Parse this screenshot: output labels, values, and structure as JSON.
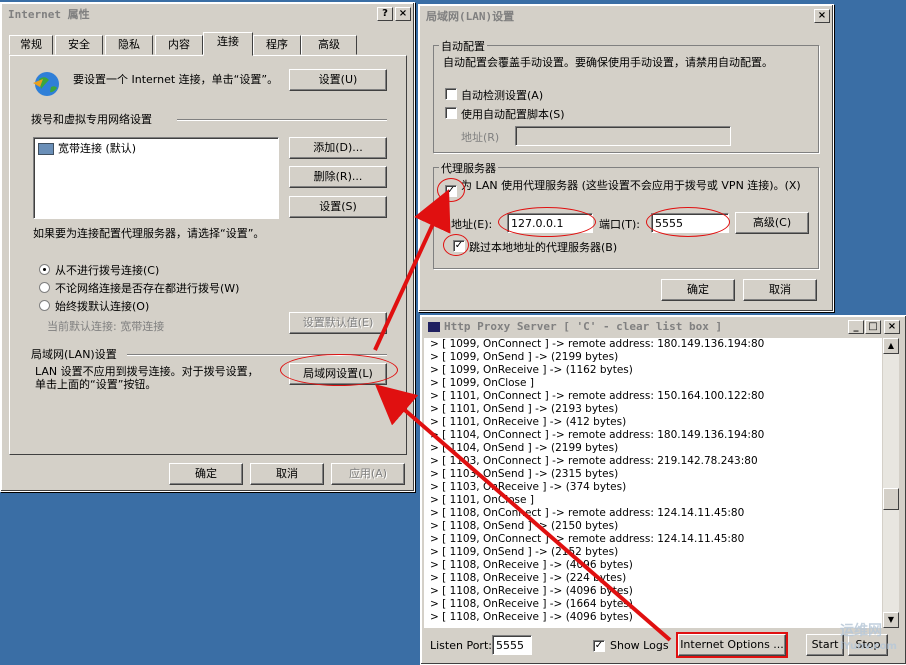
{
  "inet": {
    "title": "Internet 属性",
    "help_btn": "?",
    "close_btn": "×",
    "tabs": [
      "常规",
      "安全",
      "隐私",
      "内容",
      "连接",
      "程序",
      "高级"
    ],
    "active_tab": "连接",
    "setup_text": "要设置一个 Internet 连接，单击“设置”。",
    "setup_btn": "设置(U)",
    "dial_section": "拨号和虚拟专用网络设置",
    "dial_list": [
      "宽带连接 (默认)"
    ],
    "add_btn": "添加(D)...",
    "remove_btn": "删除(R)...",
    "settings_btn": "设置(S)",
    "proxy_hint": "如果要为连接配置代理服务器，请选择“设置”。",
    "radio_never": "从不进行拨号连接(C)",
    "radio_when_none": "不论网络连接是否存在都进行拨号(W)",
    "radio_always": "始终拨默认连接(O)",
    "current_default_label": "当前默认连接:",
    "current_default_value": "宽带连接",
    "set_default_btn": "设置默认值(E)",
    "lan_section": "局域网(LAN)设置",
    "lan_text": "LAN 设置不应用到拨号连接。对于拨号设置，单击上面的“设置”按钮。",
    "lan_btn": "局域网设置(L)",
    "ok_btn": "确定",
    "cancel_btn": "取消",
    "apply_btn": "应用(A)"
  },
  "lan": {
    "title": "局域网(LAN)设置",
    "close_btn": "×",
    "auto_group": "自动配置",
    "auto_desc": "自动配置会覆盖手动设置。要确保使用手动设置，请禁用自动配置。",
    "auto_detect": "自动检测设置(A)",
    "auto_script": "使用自动配置脚本(S)",
    "address_label": "地址(R)",
    "proxy_group": "代理服务器",
    "use_proxy": "为 LAN 使用代理服务器 (这些设置不会应用于拨号或 VPN 连接)。(X)",
    "addr_label": "地址(E):",
    "addr_value": "127.0.0.1",
    "port_label": "端口(T):",
    "port_value": "5555",
    "advanced_btn": "高级(C)",
    "bypass_local": "跳过本地地址的代理服务器(B)",
    "ok_btn": "确定",
    "cancel_btn": "取消"
  },
  "proxy": {
    "title": "Http Proxy Server [ 'C' - clear list box ]",
    "log": [
      "> [ 1099, OnConnect ] -> remote address: 180.149.136.194:80",
      "> [ 1099, OnSend ] -> (2199 bytes)",
      "> [ 1099, OnReceive ] -> (1162 bytes)",
      "> [ 1099, OnClose ]",
      "> [ 1101, OnConnect ] -> remote address: 150.164.100.122:80",
      "> [ 1101, OnSend ] -> (2193 bytes)",
      "> [ 1101, OnReceive ] -> (412 bytes)",
      "> [ 1104, OnConnect ] -> remote address: 180.149.136.194:80",
      "> [ 1104, OnSend ] -> (2199 bytes)",
      "> [ 1103, OnConnect ] -> remote address: 219.142.78.243:80",
      "> [ 1103, OnSend ] -> (2315 bytes)",
      "> [ 1103, OnReceive ] -> (374 bytes)",
      "> [ 1101, OnClose ]",
      "> [ 1108, OnConnect ] -> remote address: 124.14.11.45:80",
      "> [ 1108, OnSend ] -> (2150 bytes)",
      "> [ 1109, OnConnect ] -> remote address: 124.14.11.45:80",
      "> [ 1109, OnSend ] -> (2152 bytes)",
      "> [ 1108, OnReceive ] -> (4096 bytes)",
      "> [ 1108, OnReceive ] -> (224 bytes)",
      "> [ 1108, OnReceive ] -> (4096 bytes)",
      "> [ 1108, OnReceive ] -> (1664 bytes)",
      "> [ 1108, OnReceive ] -> (4096 bytes)"
    ],
    "listen_port_label": "Listen Port:",
    "listen_port_value": "5555",
    "show_logs": "Show Logs",
    "internet_options_btn": "Internet Options ...",
    "start_btn": "Start",
    "stop_btn": "Stop"
  },
  "watermark": {
    "line1": "运维网",
    "line2": "iYunv.com"
  },
  "colors": {
    "desktop": "#3a6ea5",
    "window": "#d4d0c8",
    "annotation": "#e01010"
  }
}
